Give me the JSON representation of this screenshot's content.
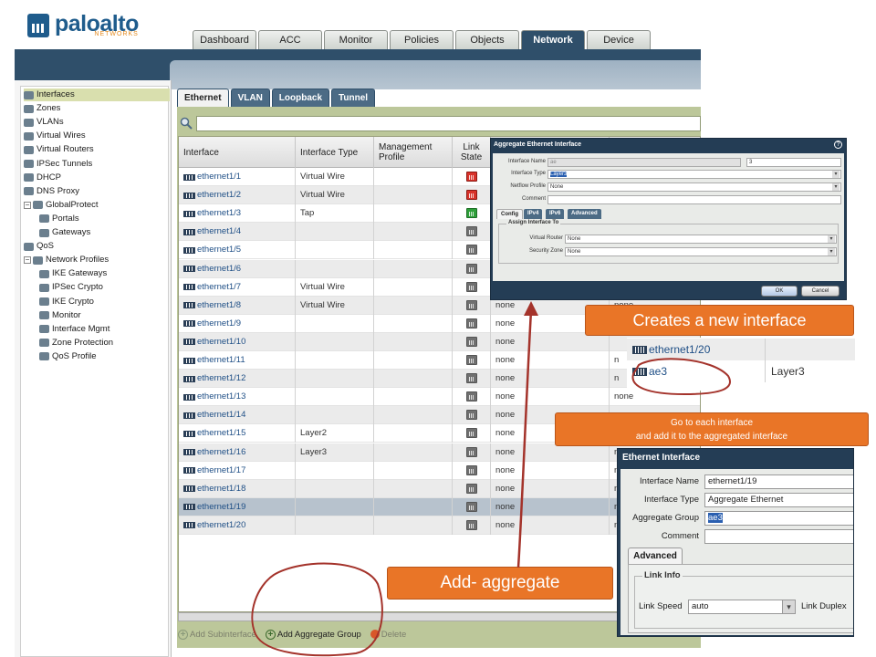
{
  "brand": {
    "name": "paloalto",
    "sub": "NETWORKS"
  },
  "topnav": [
    "Dashboard",
    "ACC",
    "Monitor",
    "Policies",
    "Objects",
    "Network",
    "Device"
  ],
  "topnav_active": "Network",
  "sidebar": [
    {
      "label": "Interfaces",
      "selected": true,
      "indent": 0
    },
    {
      "label": "Zones",
      "indent": 0
    },
    {
      "label": "VLANs",
      "indent": 0
    },
    {
      "label": "Virtual Wires",
      "indent": 0
    },
    {
      "label": "Virtual Routers",
      "indent": 0
    },
    {
      "label": "IPSec Tunnels",
      "indent": 0
    },
    {
      "label": "DHCP",
      "indent": 0
    },
    {
      "label": "DNS Proxy",
      "indent": 0
    },
    {
      "label": "GlobalProtect",
      "indent": 0,
      "toggle": "−"
    },
    {
      "label": "Portals",
      "indent": 1
    },
    {
      "label": "Gateways",
      "indent": 1
    },
    {
      "label": "QoS",
      "indent": 0
    },
    {
      "label": "Network Profiles",
      "indent": 0,
      "toggle": "−"
    },
    {
      "label": "IKE Gateways",
      "indent": 1
    },
    {
      "label": "IPSec Crypto",
      "indent": 1
    },
    {
      "label": "IKE Crypto",
      "indent": 1
    },
    {
      "label": "Monitor",
      "indent": 1
    },
    {
      "label": "Interface Mgmt",
      "indent": 1
    },
    {
      "label": "Zone Protection",
      "indent": 1
    },
    {
      "label": "QoS Profile",
      "indent": 1
    }
  ],
  "subtabs": [
    "Ethernet",
    "VLAN",
    "Loopback",
    "Tunnel"
  ],
  "table": {
    "headers": [
      "Interface",
      "Interface Type",
      "Management Profile",
      "Link State"
    ],
    "rows": [
      {
        "iface": "ethernet1/1",
        "type": "Virtual Wire",
        "link": "down"
      },
      {
        "iface": "ethernet1/2",
        "type": "Virtual Wire",
        "link": "down"
      },
      {
        "iface": "ethernet1/3",
        "type": "Tap",
        "link": "up"
      },
      {
        "iface": "ethernet1/4",
        "type": "",
        "link": "na"
      },
      {
        "iface": "ethernet1/5",
        "type": "",
        "link": "na"
      },
      {
        "iface": "ethernet1/6",
        "type": "",
        "link": "na"
      },
      {
        "iface": "ethernet1/7",
        "type": "Virtual Wire",
        "link": "na"
      },
      {
        "iface": "ethernet1/8",
        "type": "Virtual Wire",
        "link": "na",
        "extra": "none",
        "extra2": "none"
      },
      {
        "iface": "ethernet1/9",
        "type": "",
        "link": "na",
        "extra": "none"
      },
      {
        "iface": "ethernet1/10",
        "type": "",
        "link": "na",
        "extra": "none"
      },
      {
        "iface": "ethernet1/11",
        "type": "",
        "link": "na",
        "extra": "none",
        "extra2": "n"
      },
      {
        "iface": "ethernet1/12",
        "type": "",
        "link": "na",
        "extra": "none",
        "extra2": "n"
      },
      {
        "iface": "ethernet1/13",
        "type": "",
        "link": "na",
        "extra": "none",
        "extra2": "none"
      },
      {
        "iface": "ethernet1/14",
        "type": "",
        "link": "na",
        "extra": "none"
      },
      {
        "iface": "ethernet1/15",
        "type": "Layer2",
        "link": "na",
        "extra": "none"
      },
      {
        "iface": "ethernet1/16",
        "type": "Layer3",
        "link": "na",
        "extra": "none",
        "extra2": "n"
      },
      {
        "iface": "ethernet1/17",
        "type": "",
        "link": "na",
        "extra": "none",
        "extra2": "n"
      },
      {
        "iface": "ethernet1/18",
        "type": "",
        "link": "na",
        "extra": "none",
        "extra2": "n"
      },
      {
        "iface": "ethernet1/19",
        "type": "",
        "link": "na",
        "extra": "none",
        "extra2": "n",
        "selected": true
      },
      {
        "iface": "ethernet1/20",
        "type": "",
        "link": "na",
        "extra": "none",
        "extra2": "n"
      }
    ]
  },
  "bottombar": {
    "add_sub": "Add Subinterface",
    "add_agg": "Add Aggregate Group",
    "delete": "Delete"
  },
  "agg_dialog": {
    "title": "Aggregate Ethernet Interface",
    "name_label": "Interface Name",
    "name_prefix": "ae",
    "name_value": "3",
    "type_label": "Interface Type",
    "type_value": "Layer3",
    "netflow_label": "Netflow Profile",
    "netflow_value": "None",
    "comment_label": "Comment",
    "tabs": [
      "Config",
      "IPv4",
      "IPv6",
      "Advanced"
    ],
    "group_label": "Assign Interface To",
    "vr_label": "Virtual Router",
    "vr_value": "None",
    "zone_label": "Security Zone",
    "zone_value": "None",
    "ok": "OK",
    "cancel": "Cancel"
  },
  "callouts": {
    "creates": "Creates a new interface",
    "goto_line1": "Go to each interface",
    "goto_line2": "and add it to the aggregated interface",
    "add": "Add- aggregate"
  },
  "zoom1": [
    {
      "iface": "ethernet1/20",
      "type": ""
    },
    {
      "iface": "ae3",
      "type": "Layer3"
    }
  ],
  "eth_dialog": {
    "title": "Ethernet Interface",
    "name_label": "Interface Name",
    "name_value": "ethernet1/19",
    "type_label": "Interface Type",
    "type_value": "Aggregate Ethernet",
    "group_label": "Aggregate Group",
    "group_value": "ae3",
    "comment_label": "Comment",
    "tab": "Advanced",
    "link_info": "Link Info",
    "speed_label": "Link Speed",
    "speed_value": "auto",
    "duplex_label": "Link Duplex"
  },
  "colors": {
    "header_blue": "#2f4f6a",
    "callout_orange": "#e97527",
    "annotation_red": "#a4332b",
    "panel_green": "#bcc79a"
  }
}
